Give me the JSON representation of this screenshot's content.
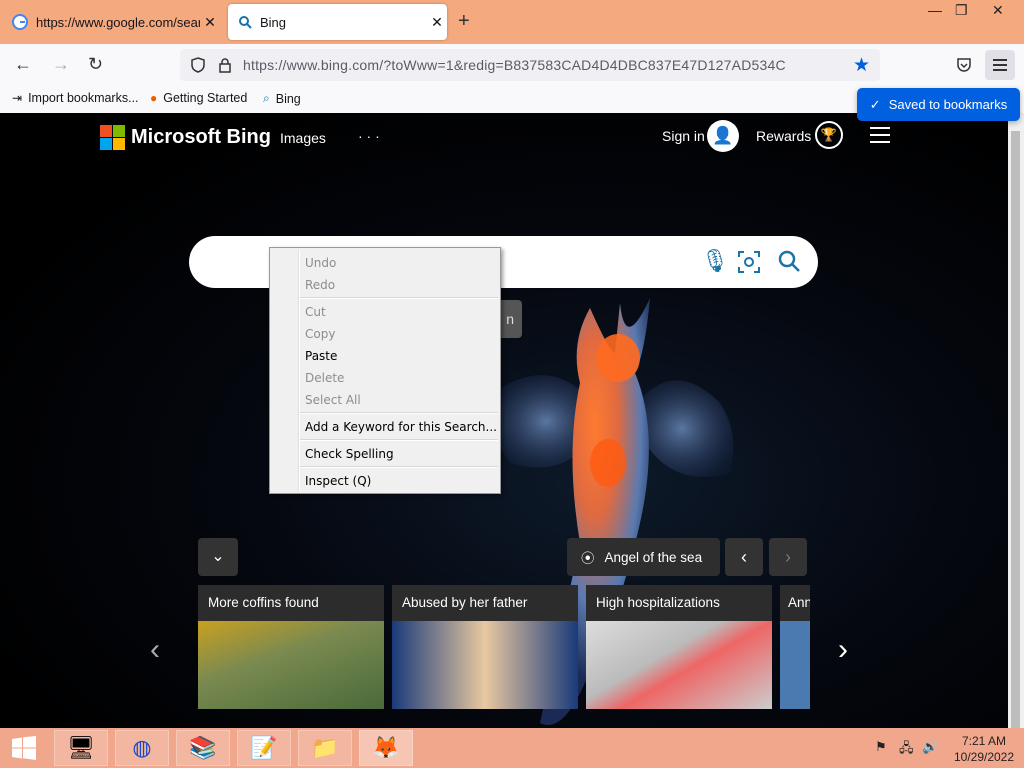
{
  "tabs": [
    {
      "title": "https://www.google.com/search?",
      "icon": "google-icon",
      "active": false
    },
    {
      "title": "Bing",
      "icon": "search-icon",
      "active": true
    }
  ],
  "window": {
    "minimize": "—",
    "restore": "❐",
    "close": "✕",
    "new_tab": "+"
  },
  "nav": {
    "url": "https://www.bing.com/?toWww=1&redig=B837583CAD4D4DBC837E47D127AD534C"
  },
  "bookmarks": [
    {
      "label": "Import bookmarks..."
    },
    {
      "label": "Getting Started"
    },
    {
      "label": "Bing"
    }
  ],
  "notification": {
    "label": "Saved to bookmarks"
  },
  "bing": {
    "logo_text": "Microsoft Bing",
    "nav_images": "Images",
    "nav_more": "· · ·",
    "sign_in": "Sign in",
    "rewards": "Rewards",
    "hidden_button_text": "n",
    "location_label": "Angel of the sea",
    "news_cards": [
      {
        "caption": "More coffins found"
      },
      {
        "caption": "Abused by her father"
      },
      {
        "caption": "High hospitalizations"
      },
      {
        "caption": "Ann"
      }
    ]
  },
  "context_menu": {
    "items": [
      {
        "label": "Undo",
        "enabled": false
      },
      {
        "label": "Redo",
        "enabled": false
      },
      {
        "label": "Cut",
        "enabled": false
      },
      {
        "label": "Copy",
        "enabled": false
      },
      {
        "label": "Paste",
        "enabled": true
      },
      {
        "label": "Delete",
        "enabled": false
      },
      {
        "label": "Select All",
        "enabled": false
      },
      {
        "label": "Add a Keyword for this Search...",
        "enabled": true
      },
      {
        "label": "Check Spelling",
        "enabled": true
      },
      {
        "label": "Inspect (Q)",
        "enabled": true
      }
    ]
  },
  "taskbar": {
    "clock_time": "7:21 AM",
    "clock_date": "10/29/2022"
  },
  "colors": {
    "accent": "#0060df",
    "titlebar": "#f4a97e",
    "taskbar": "#f1a78c",
    "bing_icon": "#1a73a8"
  }
}
